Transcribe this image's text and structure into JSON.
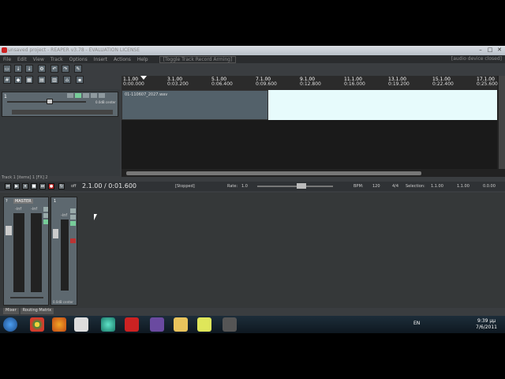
{
  "window": {
    "title": "unsaved project - REAPER v3.78 - EVALUATION LICENSE",
    "minimize": "–",
    "maximize": "□",
    "close": "✕"
  },
  "menu": {
    "items": [
      "File",
      "Edit",
      "View",
      "Track",
      "Options",
      "Insert",
      "Actions",
      "Help"
    ],
    "message": "[Toggle Track Record Arming]",
    "audio_status": "[audio device closed]"
  },
  "ruler": {
    "ticks": [
      {
        "bar": "1.1.00",
        "time": "0:00.000"
      },
      {
        "bar": "3.1.00",
        "time": "0:03.200"
      },
      {
        "bar": "5.1.00",
        "time": "0:06.400"
      },
      {
        "bar": "7.1.00",
        "time": "0:09.600"
      },
      {
        "bar": "9.1.00",
        "time": "0:12.800"
      },
      {
        "bar": "11.1.00",
        "time": "0:16.000"
      },
      {
        "bar": "13.1.00",
        "time": "0:19.200"
      },
      {
        "bar": "15.1.00",
        "time": "0:22.400"
      },
      {
        "bar": "17.1.00",
        "time": "0:25.600"
      }
    ]
  },
  "track": {
    "number": "1",
    "volume_label": "0.0dB center",
    "item_name": "01-110607_2027.wav"
  },
  "status_text": "Track 1 [items] 1 [FX] 2",
  "transport": {
    "position": "2.1.00 / 0:01.600",
    "state": "[Stopped]",
    "rate_label": "Rate:",
    "rate_value": "1.0",
    "bpm_label": "BPM:",
    "bpm_value": "120",
    "time_sig": "4/4",
    "selection_label": "Selection:",
    "sel_start": "1.1.00",
    "sel_end": "1.1.00",
    "sel_len": "0.0.00",
    "off_label": "off"
  },
  "mixer": {
    "master_label": "MASTER",
    "master_inf_left": "-inf",
    "master_inf_right": "-inf",
    "track_num": "1",
    "track_inf": "-inf",
    "scale": [
      "12",
      "6",
      "0",
      "-6",
      "-12",
      "-18",
      "-24",
      "-30",
      "-36",
      "-42",
      "-54"
    ],
    "strip_label": "0.0dB center"
  },
  "tabs": [
    "Mixer",
    "Routing Matrix"
  ],
  "taskbar": {
    "lang": "EN",
    "time": "9:39 μμ",
    "date": "7/6/2011"
  }
}
